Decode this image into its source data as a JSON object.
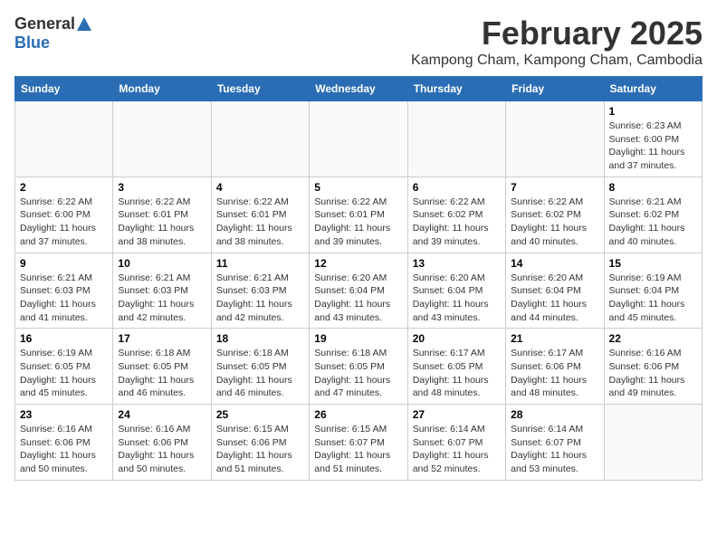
{
  "header": {
    "logo_general": "General",
    "logo_blue": "Blue",
    "month_title": "February 2025",
    "location": "Kampong Cham, Kampong Cham, Cambodia"
  },
  "weekdays": [
    "Sunday",
    "Monday",
    "Tuesday",
    "Wednesday",
    "Thursday",
    "Friday",
    "Saturday"
  ],
  "weeks": [
    [
      {
        "day": "",
        "info": ""
      },
      {
        "day": "",
        "info": ""
      },
      {
        "day": "",
        "info": ""
      },
      {
        "day": "",
        "info": ""
      },
      {
        "day": "",
        "info": ""
      },
      {
        "day": "",
        "info": ""
      },
      {
        "day": "1",
        "info": "Sunrise: 6:23 AM\nSunset: 6:00 PM\nDaylight: 11 hours\nand 37 minutes."
      }
    ],
    [
      {
        "day": "2",
        "info": "Sunrise: 6:22 AM\nSunset: 6:00 PM\nDaylight: 11 hours\nand 37 minutes."
      },
      {
        "day": "3",
        "info": "Sunrise: 6:22 AM\nSunset: 6:01 PM\nDaylight: 11 hours\nand 38 minutes."
      },
      {
        "day": "4",
        "info": "Sunrise: 6:22 AM\nSunset: 6:01 PM\nDaylight: 11 hours\nand 38 minutes."
      },
      {
        "day": "5",
        "info": "Sunrise: 6:22 AM\nSunset: 6:01 PM\nDaylight: 11 hours\nand 39 minutes."
      },
      {
        "day": "6",
        "info": "Sunrise: 6:22 AM\nSunset: 6:02 PM\nDaylight: 11 hours\nand 39 minutes."
      },
      {
        "day": "7",
        "info": "Sunrise: 6:22 AM\nSunset: 6:02 PM\nDaylight: 11 hours\nand 40 minutes."
      },
      {
        "day": "8",
        "info": "Sunrise: 6:21 AM\nSunset: 6:02 PM\nDaylight: 11 hours\nand 40 minutes."
      }
    ],
    [
      {
        "day": "9",
        "info": "Sunrise: 6:21 AM\nSunset: 6:03 PM\nDaylight: 11 hours\nand 41 minutes."
      },
      {
        "day": "10",
        "info": "Sunrise: 6:21 AM\nSunset: 6:03 PM\nDaylight: 11 hours\nand 42 minutes."
      },
      {
        "day": "11",
        "info": "Sunrise: 6:21 AM\nSunset: 6:03 PM\nDaylight: 11 hours\nand 42 minutes."
      },
      {
        "day": "12",
        "info": "Sunrise: 6:20 AM\nSunset: 6:04 PM\nDaylight: 11 hours\nand 43 minutes."
      },
      {
        "day": "13",
        "info": "Sunrise: 6:20 AM\nSunset: 6:04 PM\nDaylight: 11 hours\nand 43 minutes."
      },
      {
        "day": "14",
        "info": "Sunrise: 6:20 AM\nSunset: 6:04 PM\nDaylight: 11 hours\nand 44 minutes."
      },
      {
        "day": "15",
        "info": "Sunrise: 6:19 AM\nSunset: 6:04 PM\nDaylight: 11 hours\nand 45 minutes."
      }
    ],
    [
      {
        "day": "16",
        "info": "Sunrise: 6:19 AM\nSunset: 6:05 PM\nDaylight: 11 hours\nand 45 minutes."
      },
      {
        "day": "17",
        "info": "Sunrise: 6:18 AM\nSunset: 6:05 PM\nDaylight: 11 hours\nand 46 minutes."
      },
      {
        "day": "18",
        "info": "Sunrise: 6:18 AM\nSunset: 6:05 PM\nDaylight: 11 hours\nand 46 minutes."
      },
      {
        "day": "19",
        "info": "Sunrise: 6:18 AM\nSunset: 6:05 PM\nDaylight: 11 hours\nand 47 minutes."
      },
      {
        "day": "20",
        "info": "Sunrise: 6:17 AM\nSunset: 6:05 PM\nDaylight: 11 hours\nand 48 minutes."
      },
      {
        "day": "21",
        "info": "Sunrise: 6:17 AM\nSunset: 6:06 PM\nDaylight: 11 hours\nand 48 minutes."
      },
      {
        "day": "22",
        "info": "Sunrise: 6:16 AM\nSunset: 6:06 PM\nDaylight: 11 hours\nand 49 minutes."
      }
    ],
    [
      {
        "day": "23",
        "info": "Sunrise: 6:16 AM\nSunset: 6:06 PM\nDaylight: 11 hours\nand 50 minutes."
      },
      {
        "day": "24",
        "info": "Sunrise: 6:16 AM\nSunset: 6:06 PM\nDaylight: 11 hours\nand 50 minutes."
      },
      {
        "day": "25",
        "info": "Sunrise: 6:15 AM\nSunset: 6:06 PM\nDaylight: 11 hours\nand 51 minutes."
      },
      {
        "day": "26",
        "info": "Sunrise: 6:15 AM\nSunset: 6:07 PM\nDaylight: 11 hours\nand 51 minutes."
      },
      {
        "day": "27",
        "info": "Sunrise: 6:14 AM\nSunset: 6:07 PM\nDaylight: 11 hours\nand 52 minutes."
      },
      {
        "day": "28",
        "info": "Sunrise: 6:14 AM\nSunset: 6:07 PM\nDaylight: 11 hours\nand 53 minutes."
      },
      {
        "day": "",
        "info": ""
      }
    ]
  ]
}
